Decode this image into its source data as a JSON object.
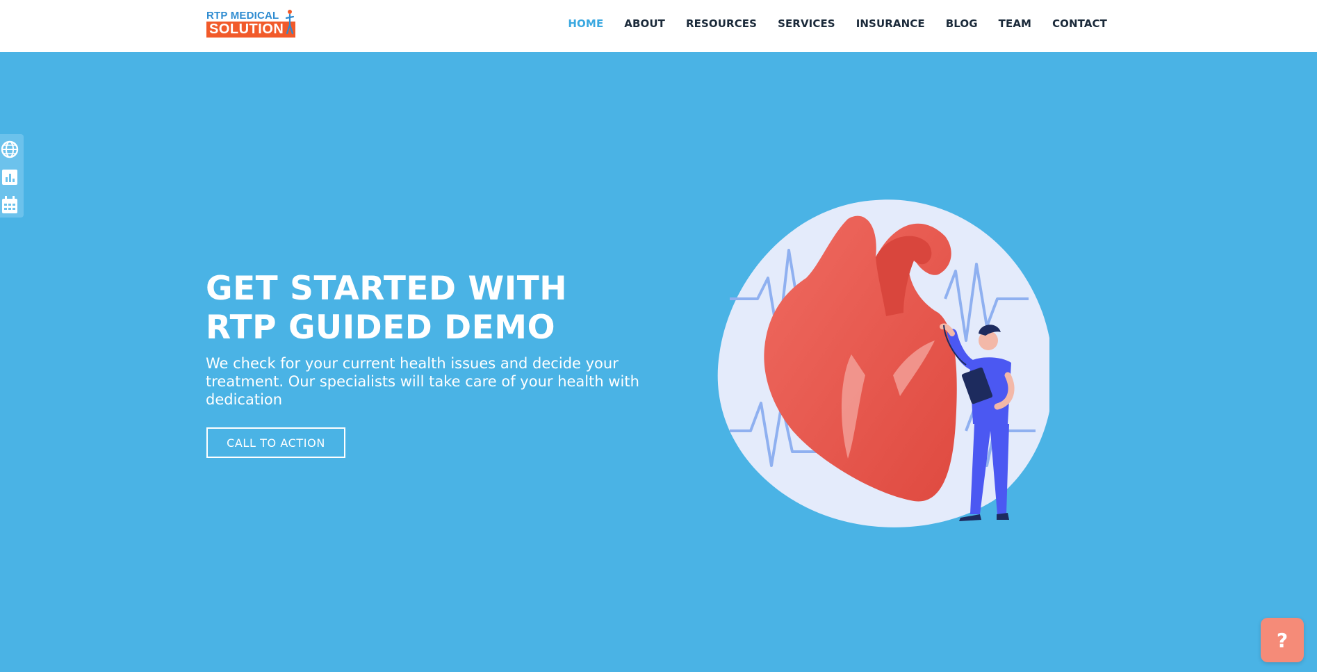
{
  "brand": {
    "logo_top": "RTP MEDICAL",
    "logo_bottom": "SOLUTION"
  },
  "nav": {
    "items": [
      {
        "label": "HOME",
        "active": true
      },
      {
        "label": "ABOUT"
      },
      {
        "label": "RESOURCES"
      },
      {
        "label": "SERVICES"
      },
      {
        "label": "INSURANCE"
      },
      {
        "label": "BLOG"
      },
      {
        "label": "TEAM"
      },
      {
        "label": "CONTACT"
      }
    ]
  },
  "side_toolbar": {
    "icons": [
      "globe-icon",
      "bar-chart-icon",
      "calendar-icon"
    ]
  },
  "hero": {
    "title_line1": "GET STARTED WITH",
    "title_line2": "RTP GUIDED DEMO",
    "subtitle": "We check for your current health issues and decide your treatment. Our specialists will take care of your health with dedication",
    "cta_label": "CALL TO ACTION"
  },
  "help": {
    "label": "?"
  },
  "colors": {
    "background": "#4ab3e5",
    "accent": "#3aa8e0",
    "logo_orange": "#f15a2a",
    "help_button": "#f58b78",
    "heart": "#e8524a"
  }
}
